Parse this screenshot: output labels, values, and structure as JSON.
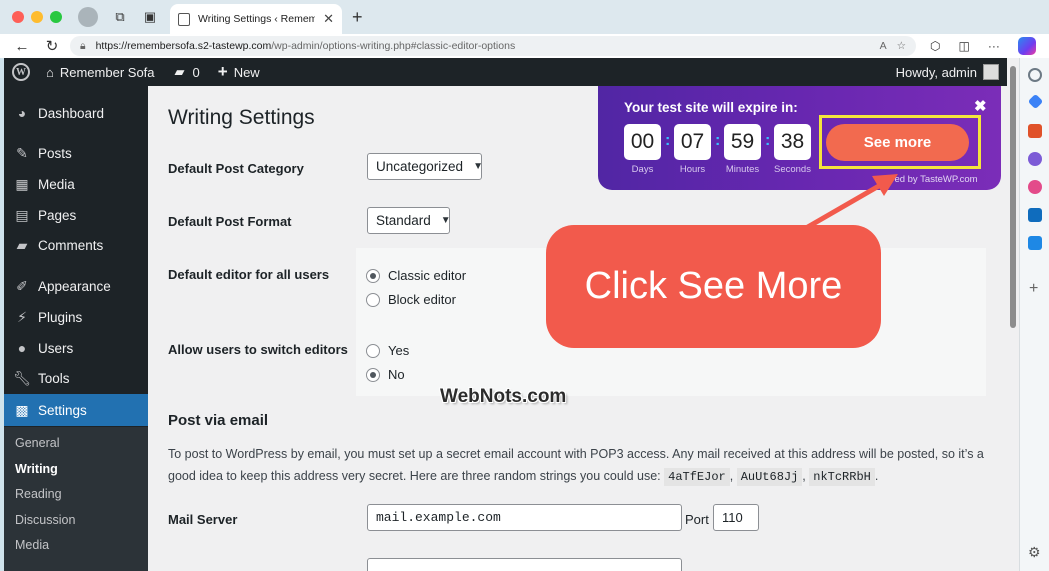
{
  "browser": {
    "tab_title": "Writing Settings ‹ Remember S",
    "url_host": "https://remembersofa.s2-tastewp.com",
    "url_path": "/wp-admin/options-writing.php#classic-editor-options"
  },
  "adminbar": {
    "site_name": "Remember Sofa",
    "comment_count": "0",
    "new_label": "New",
    "howdy": "Howdy, admin"
  },
  "menu": {
    "items": [
      {
        "label": "Dashboard",
        "icon": "dashboard-icon"
      },
      {
        "label": "Posts",
        "icon": "pin-icon"
      },
      {
        "label": "Media",
        "icon": "media-icon"
      },
      {
        "label": "Pages",
        "icon": "pages-icon"
      },
      {
        "label": "Comments",
        "icon": "comments-icon"
      },
      {
        "label": "Appearance",
        "icon": "brush-icon"
      },
      {
        "label": "Plugins",
        "icon": "plugin-icon"
      },
      {
        "label": "Users",
        "icon": "users-icon"
      },
      {
        "label": "Tools",
        "icon": "wrench-icon"
      },
      {
        "label": "Settings",
        "icon": "settings-icon"
      }
    ],
    "submenu": [
      "General",
      "Writing",
      "Reading",
      "Discussion",
      "Media"
    ]
  },
  "page": {
    "title": "Writing Settings",
    "default_category_label": "Default Post Category",
    "default_category_value": "Uncategorized",
    "default_format_label": "Default Post Format",
    "default_format_value": "Standard",
    "editor_label": "Default editor for all users",
    "editor_options": [
      "Classic editor",
      "Block editor"
    ],
    "switch_label": "Allow users to switch editors",
    "switch_options": [
      "Yes",
      "No"
    ],
    "post_via_email_title": "Post via email",
    "post_via_email_text": "To post to WordPress by email, you must set up a secret email account with POP3 access. Any mail received at this address will be posted, so it’s a good idea to keep this address very secret. Here are three random strings you could use:",
    "random_strings": [
      "4aTfEJor",
      "AuUt68Jj",
      "nkTcRRbH"
    ],
    "mail_server_label": "Mail Server",
    "mail_server_value": "mail.example.com",
    "port_label": "Port",
    "port_value": "110"
  },
  "expire_popup": {
    "heading": "Your test site will expire in:",
    "tiles": [
      {
        "value": "00",
        "label": "Days"
      },
      {
        "value": "07",
        "label": "Hours"
      },
      {
        "value": "59",
        "label": "Minutes"
      },
      {
        "value": "38",
        "label": "Seconds"
      }
    ],
    "button": "See more",
    "powered": "ered by TasteWP.com"
  },
  "annotation": {
    "callout": "Click See More",
    "watermark": "WebNots.com"
  },
  "colors": {
    "wp_dark": "#1d2327",
    "wp_blue": "#2271b1",
    "popup_purple": "#5a27a8",
    "button_coral": "#f26a4f",
    "highlight_yellow": "#f4e53c",
    "callout_red": "#f25a4c"
  }
}
